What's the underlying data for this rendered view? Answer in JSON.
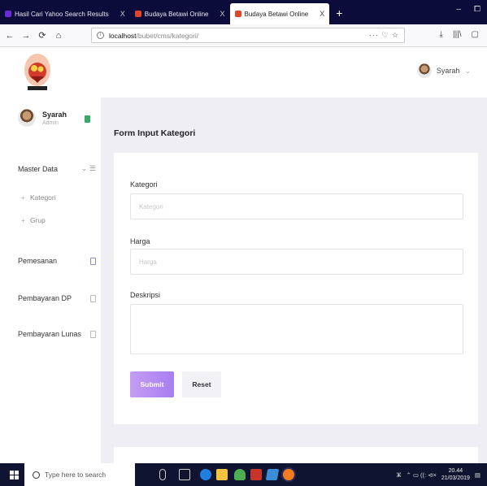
{
  "browser": {
    "tabs": [
      {
        "label": "Hasil Cari Yahoo Search Results",
        "fav_color": "#6c2bd9",
        "active": false
      },
      {
        "label": "Budaya Betawi Online",
        "fav_color": "#e0452c",
        "active": false
      },
      {
        "label": "Budaya Betawi Online",
        "fav_color": "#e0452c",
        "active": true
      }
    ],
    "tab_close": "X",
    "new_tab": "+",
    "window_controls": [
      "–",
      "⧠"
    ],
    "url_host": "localhost",
    "url_path": "/bubet/cms/kategori/",
    "url_right_icons": "··· ♡ ☆",
    "nav_icons": [
      "←",
      "→",
      "⟳",
      "⌂"
    ],
    "toolbar_right_icons": [
      "⤓",
      "|||\\",
      "▢"
    ]
  },
  "header": {
    "user_name": "Syarah",
    "caret": "⌄"
  },
  "sidebar": {
    "user": {
      "name": "Syarah",
      "role": "Admin"
    },
    "master_data": {
      "label": "Master Data",
      "icons": "⌄ ☰"
    },
    "sub_items": [
      {
        "label": "Kategori"
      },
      {
        "label": "Grup"
      }
    ],
    "items": [
      {
        "label": "Pemesanan"
      },
      {
        "label": "Pembayaran DP"
      },
      {
        "label": "Pembayaran Lunas"
      }
    ],
    "plus": "+"
  },
  "main": {
    "title": "Form Input Kategori",
    "fields": {
      "kategori": {
        "label": "Kategori",
        "placeholder": "Kategori"
      },
      "harga": {
        "label": "Harga",
        "placeholder": "Harga"
      },
      "deskripsi": {
        "label": "Deskripsi",
        "placeholder": ""
      }
    },
    "submit_label": "Submit",
    "reset_label": "Reset"
  },
  "taskbar": {
    "search_placeholder": "Type here to search",
    "time": "20.44",
    "date": "21/03/2019",
    "tray_text": "⌃ ▭ ((: ⊲×"
  }
}
